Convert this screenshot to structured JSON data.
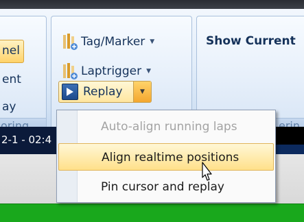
{
  "ribbon": {
    "left_group": {
      "fragments": [
        "nel",
        "ent",
        "ay"
      ],
      "label_fragment": "oring"
    },
    "tools_group": {
      "tag_marker_label": "Tag/Marker",
      "laptrigger_label": "Laptrigger",
      "replay_label": "Replay"
    },
    "right_group": {
      "show_current_label": "Show Current",
      "label_fragment": "erin"
    }
  },
  "timeline": {
    "timestamp_fragment": "2-1 - 02:4"
  },
  "replay_menu": {
    "items": [
      {
        "label": "Auto-align running laps",
        "enabled": false
      },
      {
        "label": "Align realtime positions",
        "enabled": true,
        "highlighted": true
      },
      {
        "label": "Pin cursor and replay",
        "enabled": true
      }
    ]
  },
  "colors": {
    "accent_orange": "#f4a72f",
    "highlight_yellow": "#ffe08a",
    "ribbon_blue": "#d2e2f4",
    "timeline_green": "#19a81c"
  },
  "icons": {
    "tag_marker": "tag-marker-icon",
    "laptrigger": "laptrigger-icon",
    "replay": "play-icon",
    "dropdown": "chevron-down-icon"
  }
}
